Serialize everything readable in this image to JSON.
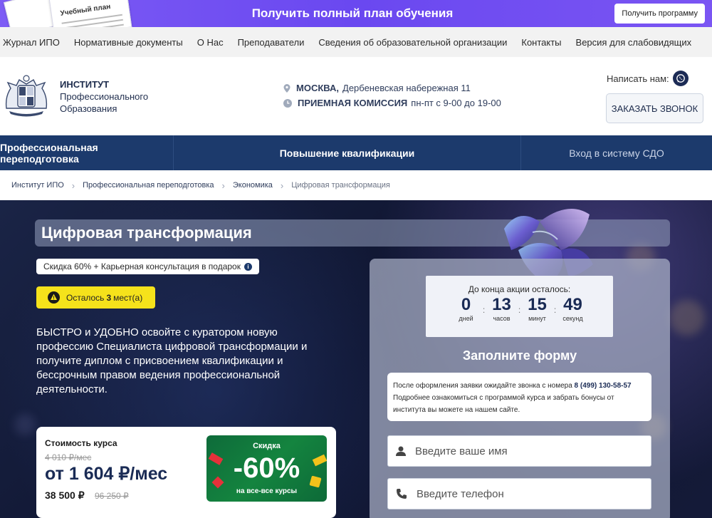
{
  "promo": {
    "doc_label": "Учебный план",
    "title": "Получить полный план обучения",
    "button": "Получить программу"
  },
  "topnav": [
    "Журнал ИПО",
    "Нормативные документы",
    "О Нас",
    "Преподаватели",
    "Сведения об образовательной организации",
    "Контакты",
    "Версия для слабовидящих"
  ],
  "header": {
    "inst_line1": "ИНСТИТУТ",
    "inst_line2": "Профессионального",
    "inst_line3": "Образования",
    "city": "МОСКВА,",
    "address": "Дербеневская набережная 11",
    "admission": "ПРИЕМНАЯ КОМИССИЯ",
    "hours": "пн-пт с 9-00 до 19-00",
    "write_us": "Написать нам:",
    "call_button": "ЗАКАЗАТЬ ЗВОНОК"
  },
  "mainnav": [
    "Профессиональная переподготовка",
    "Повышение квалификации",
    "Вход в систему СДО"
  ],
  "breadcrumb": [
    "Институт ИПО",
    "Профессиональная переподготовка",
    "Экономика",
    "Цифровая трансформация"
  ],
  "hero": {
    "title": "Цифровая трансформация",
    "offer": "Скидка 60% + Карьерная консультация в подарок",
    "seats_prefix": "Осталось",
    "seats_count": "3",
    "seats_suffix": "мест(а)",
    "lead": "БЫСТРО и УДОБНО освойте с куратором новую профессию Специалиста цифровой трансформации и получите диплом с присвоением квалификации и бессрочным правом ведения профессиональной деятельности."
  },
  "price": {
    "label": "Стоимость курса",
    "old_monthly": "4 010 ₽/мес",
    "monthly": "от 1 604 ₽/мес",
    "total": "38 500 ₽",
    "old_total": "96 250 ₽",
    "disc_label": "Скидка",
    "disc_value": "-60%",
    "disc_note": "на все-все курсы"
  },
  "form": {
    "timer_label": "До конца акции осталось:",
    "days": "0",
    "days_unit": "дней",
    "hours": "13",
    "hours_unit": "часов",
    "minutes": "15",
    "minutes_unit": "минут",
    "seconds": "49",
    "seconds_unit": "секунд",
    "title": "Заполните форму",
    "note_text": "После оформления заявки ожидайте звонка с номера",
    "phone": "8 (499) 130-58-57",
    "note_text2": "Подробнее ознакомиться с программой курса и забрать бонусы от института вы можете на нашем сайте.",
    "name_placeholder": "Введите ваше имя",
    "phone_placeholder": "Введите телефон"
  }
}
